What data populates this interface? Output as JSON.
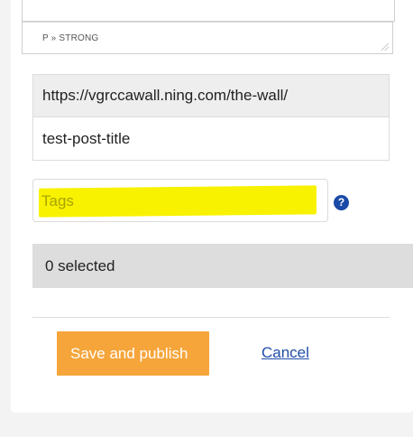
{
  "editor": {
    "status_path": "P » STRONG"
  },
  "url": {
    "base": "https://vgrccawall.ning.com/the-wall/",
    "slug": "test-post-title"
  },
  "tags": {
    "placeholder": "Tags",
    "help_symbol": "?"
  },
  "selection": {
    "text": "0 selected"
  },
  "actions": {
    "save_label": "Save and publish",
    "cancel_label": "Cancel"
  },
  "colors": {
    "save_button": "#f6a53a",
    "highlight": "#f8f200",
    "link": "#1f4ea8",
    "help_icon": "#1a4aa6"
  }
}
